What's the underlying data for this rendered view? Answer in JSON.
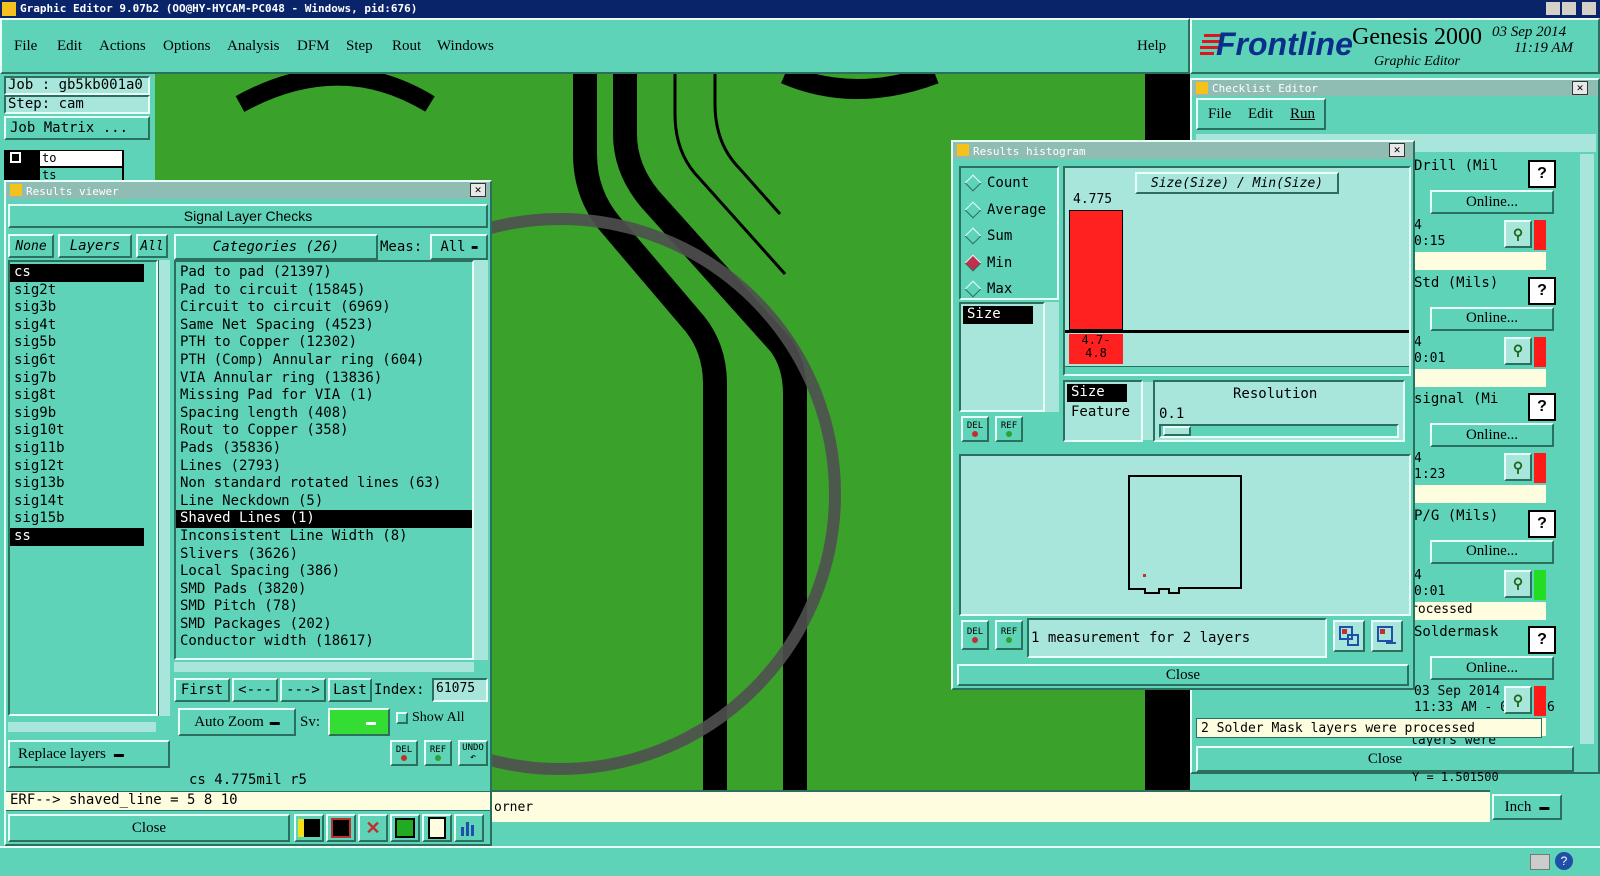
{
  "app": {
    "title": "Graphic Editor 9.07b2 (OO@HY-HYCAM-PC048 - Windows, pid:676)",
    "menu": [
      "File",
      "Edit",
      "Actions",
      "Options",
      "Analysis",
      "DFM",
      "Step",
      "Rout",
      "Windows"
    ],
    "help": "Help",
    "brand": "Frontline",
    "product": "Genesis 2000",
    "product_sub": "Graphic Editor",
    "date": "03 Sep 2014",
    "time": "11:19 AM"
  },
  "job": {
    "job_label": "Job : gb5kb001a0",
    "step_label": "Step: cam",
    "matrix_button": "Job Matrix ...",
    "layer_rows": [
      "to",
      "ts"
    ]
  },
  "results_viewer": {
    "title": "Results viewer",
    "header": "Signal Layer Checks",
    "none_btn": "None",
    "layers_btn": "Layers",
    "all_btn": "All",
    "layers": [
      "cs",
      "sig2t",
      "sig3b",
      "sig4t",
      "sig5b",
      "sig6t",
      "sig7b",
      "sig8t",
      "sig9b",
      "sig10t",
      "sig11b",
      "sig12t",
      "sig13b",
      "sig14t",
      "sig15b",
      "ss"
    ],
    "categories_label": "Categories (26)",
    "meas_label": "Meas:",
    "meas_value": "All",
    "categories": [
      "Pad to pad (21397)",
      "Pad to circuit (15845)",
      "Circuit to circuit (6969)",
      "Same Net Spacing (4523)",
      "PTH to Copper (12302)",
      "PTH (Comp) Annular ring (604)",
      "VIA Annular ring (13836)",
      "Missing Pad for VIA (1)",
      "Spacing length (408)",
      "Rout to Copper (358)",
      "Pads (35836)",
      "Lines (2793)",
      "Non standard rotated lines (63)",
      "Line Neckdown (5)",
      "Shaved Lines (1)",
      "Inconsistent Line Width (8)",
      "Slivers (3626)",
      "Local Spacing (386)",
      "SMD Pads (3820)",
      "SMD Pitch (78)",
      "SMD Packages (202)",
      "Conductor width (18617)"
    ],
    "selected_category": "Shaved Lines (1)",
    "nav": {
      "first": "First",
      "prev": "<---",
      "next": "--->",
      "last": "Last",
      "index_label": "Index:",
      "index_value": "61075"
    },
    "auto_zoom": "Auto Zoom",
    "sv_label": "Sv:",
    "show_all": "Show All",
    "replace_layers": "Replace layers",
    "status": "cs 4.775mil  r5",
    "erf": "ERF--> shaved_line = 5 8 10",
    "close": "Close",
    "del": "DEL",
    "ref": "REF",
    "undo": "UNDO"
  },
  "histogram": {
    "title": "Results histogram",
    "modes": [
      "Count",
      "Average",
      "Sum",
      "Min",
      "Max"
    ],
    "selected_mode": "Min",
    "attr_list": [
      "Size"
    ],
    "chart_title": "Size(Size) / Min(Size)",
    "bar_label": "4.775",
    "bin_label_1": "4.7-",
    "bin_label_2": "4.8",
    "size_option": "Size",
    "feature_option": "Feature",
    "resolution_label": "Resolution",
    "resolution_value": "0.1",
    "info": "1 measurement for 2 layers",
    "close": "Close",
    "del": "DEL",
    "ref": "REF"
  },
  "checklist": {
    "title": "Checklist Editor",
    "menu": [
      "File",
      "Edit",
      "Run"
    ],
    "rows": [
      {
        "name": "Drill (Mil",
        "online": "Online...",
        "time": "4",
        "time2": "0:15",
        "status_color": "#ff1a1a",
        "msg": ""
      },
      {
        "name": "Std (Mils)",
        "online": "Online...",
        "time": "4",
        "time2": "0:01",
        "status_color": "#ff1a1a",
        "msg": ""
      },
      {
        "name": "signal (Mi",
        "online": "Online...",
        "time": "4",
        "time2": "1:23",
        "status_color": "#ff1a1a",
        "msg": ""
      },
      {
        "name": "P/G (Mils)",
        "online": "Online...",
        "time": "4",
        "time2": "0:01",
        "status_color": "#22dd22",
        "msg": "rocessed"
      },
      {
        "name": "Soldermask",
        "online": "Online...",
        "time": "03 Sep 2014",
        "time2": "11:33 AM - 0:02:26",
        "status_color": "#ff1a1a",
        "msg": "2 Solder Mask layers were processed"
      }
    ],
    "close": "Close",
    "help_q": "?"
  },
  "bottom": {
    "prompt_text": "orner",
    "units": "Inch",
    "hidden_coord": "Y = 1.501500"
  },
  "colors": {
    "panel": "#5fd3b8",
    "light": "#a8e6dc",
    "board": "#3aa12a",
    "bar": "#ff2020"
  }
}
